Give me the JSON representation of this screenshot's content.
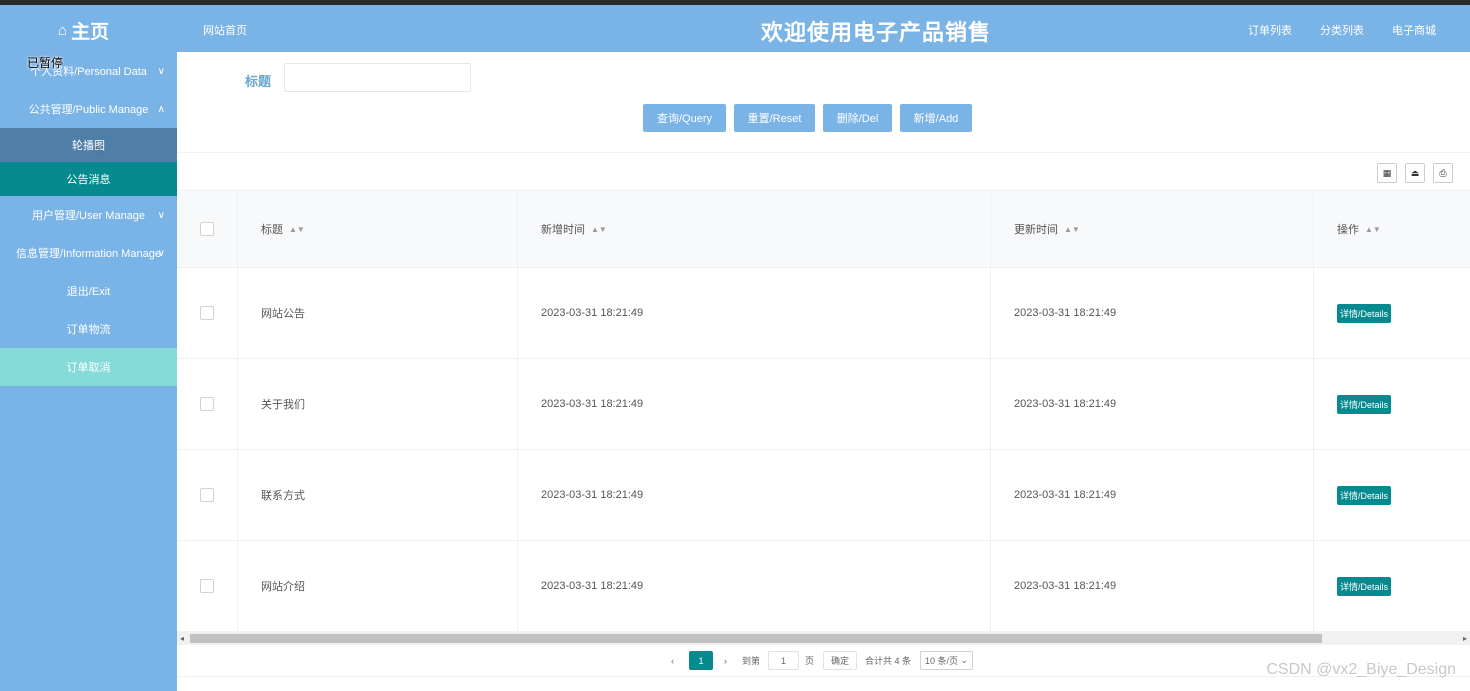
{
  "header": {
    "home_icon": "home-icon",
    "home_label": "主页",
    "nav_home": "网站首页",
    "site_title": "欢迎使用电子产品销售",
    "links": [
      "订单列表",
      "分类列表",
      "电子商城"
    ]
  },
  "overlay": {
    "paused": "已暂停"
  },
  "sidebar": {
    "items": [
      {
        "label": "个人资料/Personal Data",
        "chevron": "∨"
      },
      {
        "label": "公共管理/Public Manage",
        "chevron": "∧"
      },
      {
        "label": "轮播图"
      },
      {
        "label": "公告消息"
      },
      {
        "label": "用户管理/User Manage",
        "chevron": "∨"
      },
      {
        "label": "信息管理/Information Manage",
        "chevron": "∨"
      },
      {
        "label": "退出/Exit"
      },
      {
        "label": "订单物流"
      },
      {
        "label": "订单取消"
      }
    ]
  },
  "search": {
    "title_label": "标题",
    "title_value": "",
    "buttons": [
      "查询/Query",
      "重置/Reset",
      "删除/Del",
      "新增/Add"
    ]
  },
  "table": {
    "columns": [
      "标题",
      "新增时间",
      "更新时间",
      "操作"
    ],
    "rows": [
      {
        "title": "网站公告",
        "created": "2023-03-31 18:21:49",
        "updated": "2023-03-31 18:21:49",
        "action": "详情/Details"
      },
      {
        "title": "关于我们",
        "created": "2023-03-31 18:21:49",
        "updated": "2023-03-31 18:21:49",
        "action": "详情/Details"
      },
      {
        "title": "联系方式",
        "created": "2023-03-31 18:21:49",
        "updated": "2023-03-31 18:21:49",
        "action": "详情/Details"
      },
      {
        "title": "网站介绍",
        "created": "2023-03-31 18:21:49",
        "updated": "2023-03-31 18:21:49",
        "action": "详情/Details"
      }
    ]
  },
  "pagination": {
    "current_page": "1",
    "goto_label": "到第",
    "goto_value": "1",
    "page_unit": "页",
    "confirm": "确定",
    "total": "合计共 4 条",
    "page_size": "10 条/页"
  },
  "watermark": "CSDN @vx2_Biye_Design",
  "colors": {
    "primary": "#7ab3e6",
    "accent_teal": "#078a8f",
    "highlight": "#85dada"
  }
}
